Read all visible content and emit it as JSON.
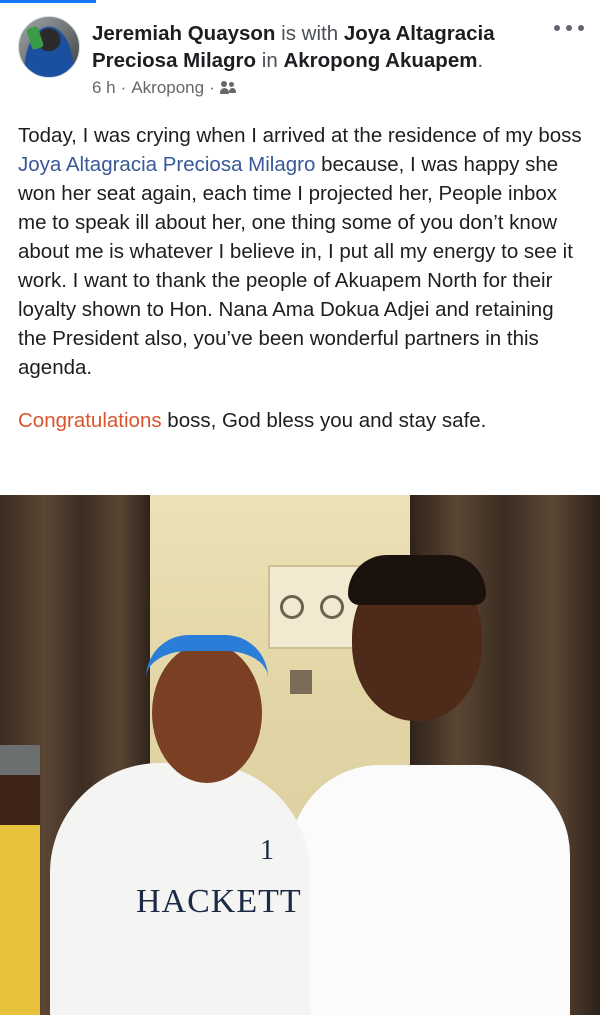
{
  "header": {
    "author": "Jeremiah Quayson",
    "with_text": "is with",
    "tagged": "Joya Altagracia Preciosa Milagro",
    "in_text": "in",
    "place": "Akropong Akuapem",
    "period": ".",
    "time": "6 h",
    "location": "Akropong",
    "dot": "·",
    "audience_icon": "friends-icon"
  },
  "post": {
    "p1_before": "Today, I was crying when I arrived at the residence of my boss ",
    "mention": "Joya Altagracia Preciosa Milagro",
    "p1_after": "  because, I was happy she won her seat again, each time I projected her, People inbox me to speak ill about her, one thing some of you don’t know about me is whatever I believe in, I put all my energy to see it work. I want to thank the people of Akuapem North for their loyalty shown to Hon. Nana Ama Dokua Adjei and retaining the President also, you’ve been wonderful partners in this agenda.",
    "p2_highlight": "Congratulations",
    "p2_rest": " boss, God bless you and stay safe."
  },
  "photo": {
    "shirt_text": "HACKETT",
    "shirt_number": "1"
  },
  "colors": {
    "link": "#385898",
    "highlight": "#d9542f",
    "accent": "#1877f2"
  }
}
